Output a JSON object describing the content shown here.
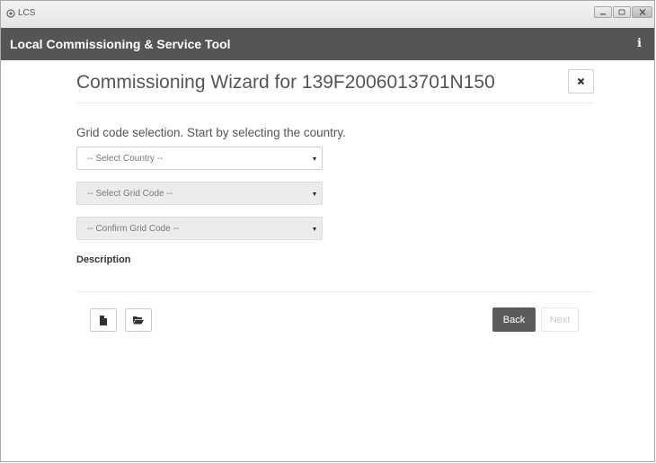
{
  "window": {
    "title": "LCS",
    "controls": [
      "minimize",
      "maximize",
      "close"
    ]
  },
  "app_header": {
    "title": "Local Commissioning & Service Tool",
    "info_icon_glyph": "i"
  },
  "wizard": {
    "title": "Commissioning Wizard for 139F2006013701N150",
    "close_glyph": "×",
    "instruction": "Grid code selection. Start by selecting the country.",
    "selects": {
      "country": {
        "value": "-- Select Country --",
        "enabled": true
      },
      "grid_code": {
        "value": "-- Select Grid Code --",
        "enabled": false
      },
      "confirm_grid_code": {
        "value": "-- Confirm Grid Code --",
        "enabled": false
      }
    },
    "description_label": "Description",
    "footer": {
      "new_file_icon": "file-icon",
      "open_folder_icon": "folder-open-icon",
      "back_label": "Back",
      "next_label": "Next"
    }
  },
  "colors": {
    "header_bg": "#555555",
    "back_button_bg": "#5b5b5b",
    "disabled_select_bg": "#ececec"
  }
}
